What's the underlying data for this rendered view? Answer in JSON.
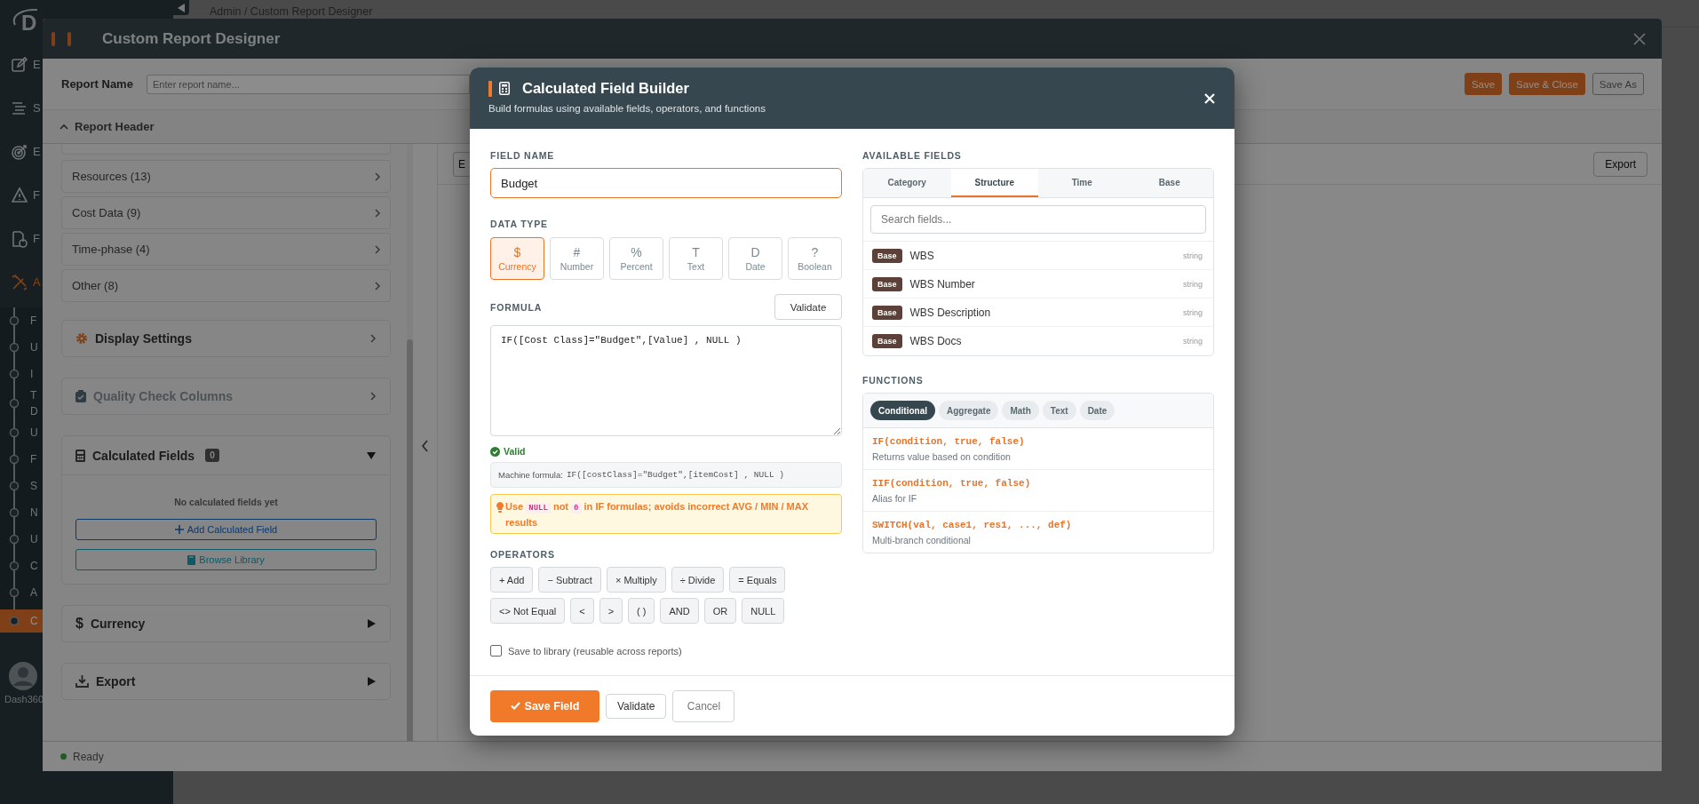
{
  "app": {
    "logo": "D",
    "breadcrumb": "Admin / Custom Report Designer",
    "nav": [
      {
        "label": "E",
        "selected": false
      },
      {
        "label": "S",
        "selected": false
      },
      {
        "label": "E",
        "selected": false
      },
      {
        "label": "F",
        "selected": false
      },
      {
        "label": "F",
        "selected": false
      },
      {
        "label": "A",
        "selected": true
      }
    ],
    "subnav": [
      {
        "label": "F",
        "selected": false
      },
      {
        "label": "U",
        "selected": false
      },
      {
        "label": "I",
        "selected": false
      },
      {
        "label": "T D",
        "selected": false
      },
      {
        "label": "U",
        "selected": false
      },
      {
        "label": "F",
        "selected": false
      },
      {
        "label": "S",
        "selected": false
      },
      {
        "label": "N",
        "selected": false
      },
      {
        "label": "U",
        "selected": false
      },
      {
        "label": "C",
        "selected": false
      },
      {
        "label": "A",
        "selected": false
      },
      {
        "label": "C",
        "selected": true
      }
    ],
    "user": "Dash360"
  },
  "designer": {
    "title": "Custom Report Designer",
    "report_name_label": "Report Name",
    "report_name_placeholder": "Enter report name...",
    "actions": [
      {
        "label": "Save",
        "kind": "primary"
      },
      {
        "label": "Save & Close",
        "kind": "primary"
      },
      {
        "label": "Save As",
        "kind": "outline"
      }
    ],
    "report_header": {
      "label": "Report Header",
      "expanded": true
    },
    "field_groups": [
      "Resources (13)",
      "Cost Data (9)",
      "Time-phase (4)",
      "Other (8)"
    ],
    "sections": [
      {
        "title": "Display Settings",
        "kind": "link",
        "disabled": false
      },
      {
        "title": "Quality Check Columns",
        "kind": "link",
        "disabled": true
      },
      {
        "title": "Calculated Fields",
        "kind": "collapsible",
        "expanded": true,
        "count": "0",
        "empty_text": "No calculated fields yet",
        "buttons": [
          {
            "label": "Add Calculated Field",
            "kind": "add"
          },
          {
            "label": "Browse Library",
            "kind": "library"
          }
        ]
      },
      {
        "title": "Currency",
        "glyph": "$",
        "kind": "collapsible",
        "expanded": false
      },
      {
        "title": "Export",
        "kind": "collapsible",
        "expanded": false
      }
    ],
    "toolbar_button": "E",
    "export_button": "Export",
    "status": "Ready"
  },
  "modal": {
    "title": "Calculated Field Builder",
    "subtitle": "Build formulas using available fields, operators, and functions",
    "field_name": {
      "label": "FIELD NAME",
      "value": "Budget"
    },
    "data_type": {
      "label": "DATA TYPE",
      "options": [
        {
          "symbol": "$",
          "label": "Currency",
          "selected": true
        },
        {
          "symbol": "#",
          "label": "Number",
          "selected": false
        },
        {
          "symbol": "%",
          "label": "Percent",
          "selected": false
        },
        {
          "symbol": "T",
          "label": "Text",
          "selected": false
        },
        {
          "symbol": "D",
          "label": "Date",
          "selected": false
        },
        {
          "symbol": "?",
          "label": "Boolean",
          "selected": false
        }
      ]
    },
    "formula": {
      "label": "FORMULA",
      "validate": "Validate",
      "value": "IF([Cost Class]=\"Budget\",[Value] , NULL )",
      "status": "Valid",
      "machine_label": "Machine formula:",
      "machine_value": "IF([costClass]=\"Budget\",[itemCost] , NULL )"
    },
    "tip": [
      {
        "kind": "text",
        "text": "Use"
      },
      {
        "kind": "code",
        "text": "NULL"
      },
      {
        "kind": "text",
        "text": "not"
      },
      {
        "kind": "code",
        "text": "0"
      },
      {
        "kind": "text",
        "text": "in IF formulas; avoids incorrect AVG / MIN / MAX results"
      }
    ],
    "operators": {
      "label": "OPERATORS",
      "items": [
        "+ Add",
        "− Subtract",
        "× Multiply",
        "÷ Divide",
        "= Equals",
        "<> Not Equal",
        "<",
        ">",
        "( )",
        "AND",
        "OR",
        "NULL"
      ]
    },
    "save_to_library": {
      "label": "Save to library (reusable across reports)",
      "checked": false
    },
    "footer": {
      "save": "Save Field",
      "validate": "Validate",
      "cancel": "Cancel"
    },
    "available_fields": {
      "label": "AVAILABLE FIELDS",
      "tabs": [
        {
          "label": "Category",
          "selected": false
        },
        {
          "label": "Structure",
          "selected": true
        },
        {
          "label": "Time",
          "selected": false
        },
        {
          "label": "Base",
          "selected": false
        }
      ],
      "search_placeholder": "Search fields...",
      "fields": [
        {
          "badge": "Base",
          "name": "WBS",
          "type": "string"
        },
        {
          "badge": "Base",
          "name": "WBS Number",
          "type": "string"
        },
        {
          "badge": "Base",
          "name": "WBS Description",
          "type": "string"
        },
        {
          "badge": "Base",
          "name": "WBS Docs",
          "type": "string"
        }
      ]
    },
    "functions": {
      "label": "FUNCTIONS",
      "tabs": [
        {
          "label": "Conditional",
          "selected": true
        },
        {
          "label": "Aggregate",
          "selected": false
        },
        {
          "label": "Math",
          "selected": false
        },
        {
          "label": "Text",
          "selected": false
        },
        {
          "label": "Date",
          "selected": false
        }
      ],
      "items": [
        {
          "signature": "IF(condition, true, false)",
          "description": "Returns value based on condition"
        },
        {
          "signature": "IIF(condition, true, false)",
          "description": "Alias for IF"
        },
        {
          "signature": "SWITCH(val, case1, res1, ..., def)",
          "description": "Multi-branch conditional"
        }
      ]
    }
  }
}
